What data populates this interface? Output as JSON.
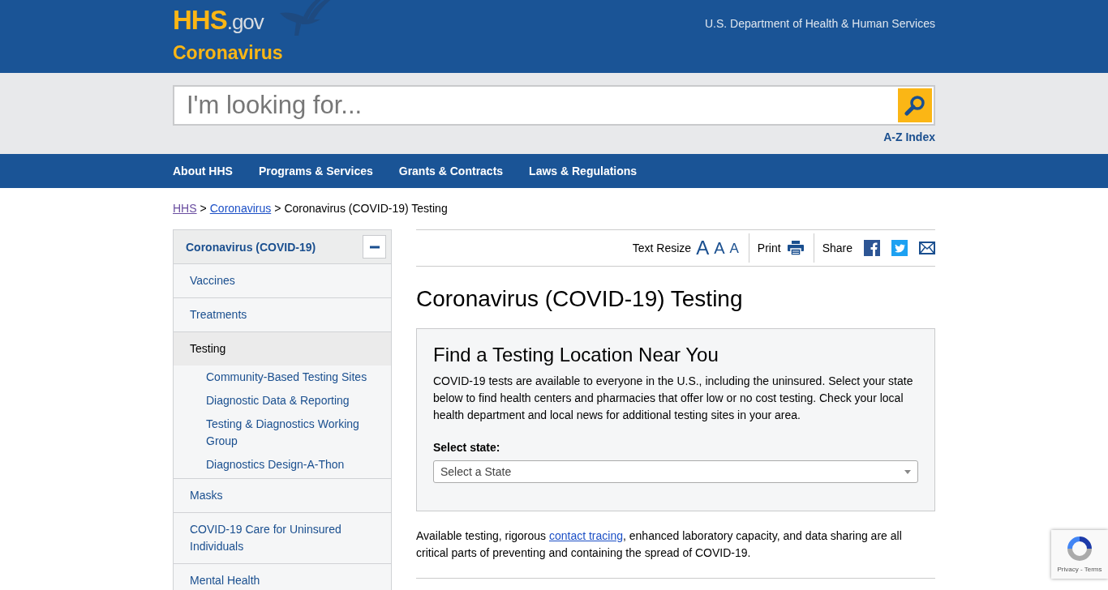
{
  "header": {
    "logo_main": "HHS",
    "logo_suffix": ".gov",
    "site_title": "Coronavirus",
    "agency": "U.S. Department of Health & Human Services"
  },
  "search": {
    "placeholder": "I'm looking for...",
    "az_index": "A-Z Index"
  },
  "nav": [
    "About HHS",
    "Programs & Services",
    "Grants & Contracts",
    "Laws & Regulations"
  ],
  "breadcrumb": [
    {
      "label": "HHS",
      "kind": "visited"
    },
    {
      "label": ">",
      "kind": "separator"
    },
    {
      "label": "Coronavirus",
      "kind": "link"
    },
    {
      "label": ">",
      "kind": "separator"
    },
    {
      "label": "Coronavirus (COVID-19) Testing",
      "kind": "current"
    }
  ],
  "sidebar": {
    "title": "Coronavirus (COVID-19)",
    "expanded": true,
    "items": [
      {
        "label": "Vaccines",
        "selected": false
      },
      {
        "label": "Treatments",
        "selected": false
      },
      {
        "label": "Testing",
        "selected": true,
        "children": [
          {
            "label": "Community-Based Testing Sites"
          },
          {
            "label": "Diagnostic Data & Reporting"
          },
          {
            "label": "Testing & Diagnostics Working Group"
          },
          {
            "label": "Diagnostics Design-A-Thon"
          }
        ]
      },
      {
        "label": "Masks",
        "selected": false
      },
      {
        "label": "COVID-19 Care for Uninsured Individuals",
        "selected": false
      },
      {
        "label": "Mental Health",
        "selected": false
      }
    ]
  },
  "toolbar": {
    "text_resize_label": "Text Resize",
    "text_sizes": [
      "A",
      "A",
      "A"
    ],
    "print": "Print",
    "share": "Share"
  },
  "page_title": "Coronavirus (COVID-19) Testing",
  "find_box": {
    "heading": "Find a Testing Location Near You",
    "text": "COVID-19 tests are available to everyone in the U.S., including the uninsured. Select your state below to find health centers and pharmacies that offer low or no cost testing. Check your local health department and local news for additional testing sites in your area.",
    "select_label": "Select state:",
    "select_placeholder": "Select a State"
  },
  "paragraph": {
    "before": "Available testing, rigorous ",
    "link": "contact tracing",
    "after": ", enhanced laboratory capacity, and data sharing are all critical parts of preventing and containing the spread of COVID-19."
  },
  "recaptcha": {
    "links": "Privacy - Terms"
  }
}
